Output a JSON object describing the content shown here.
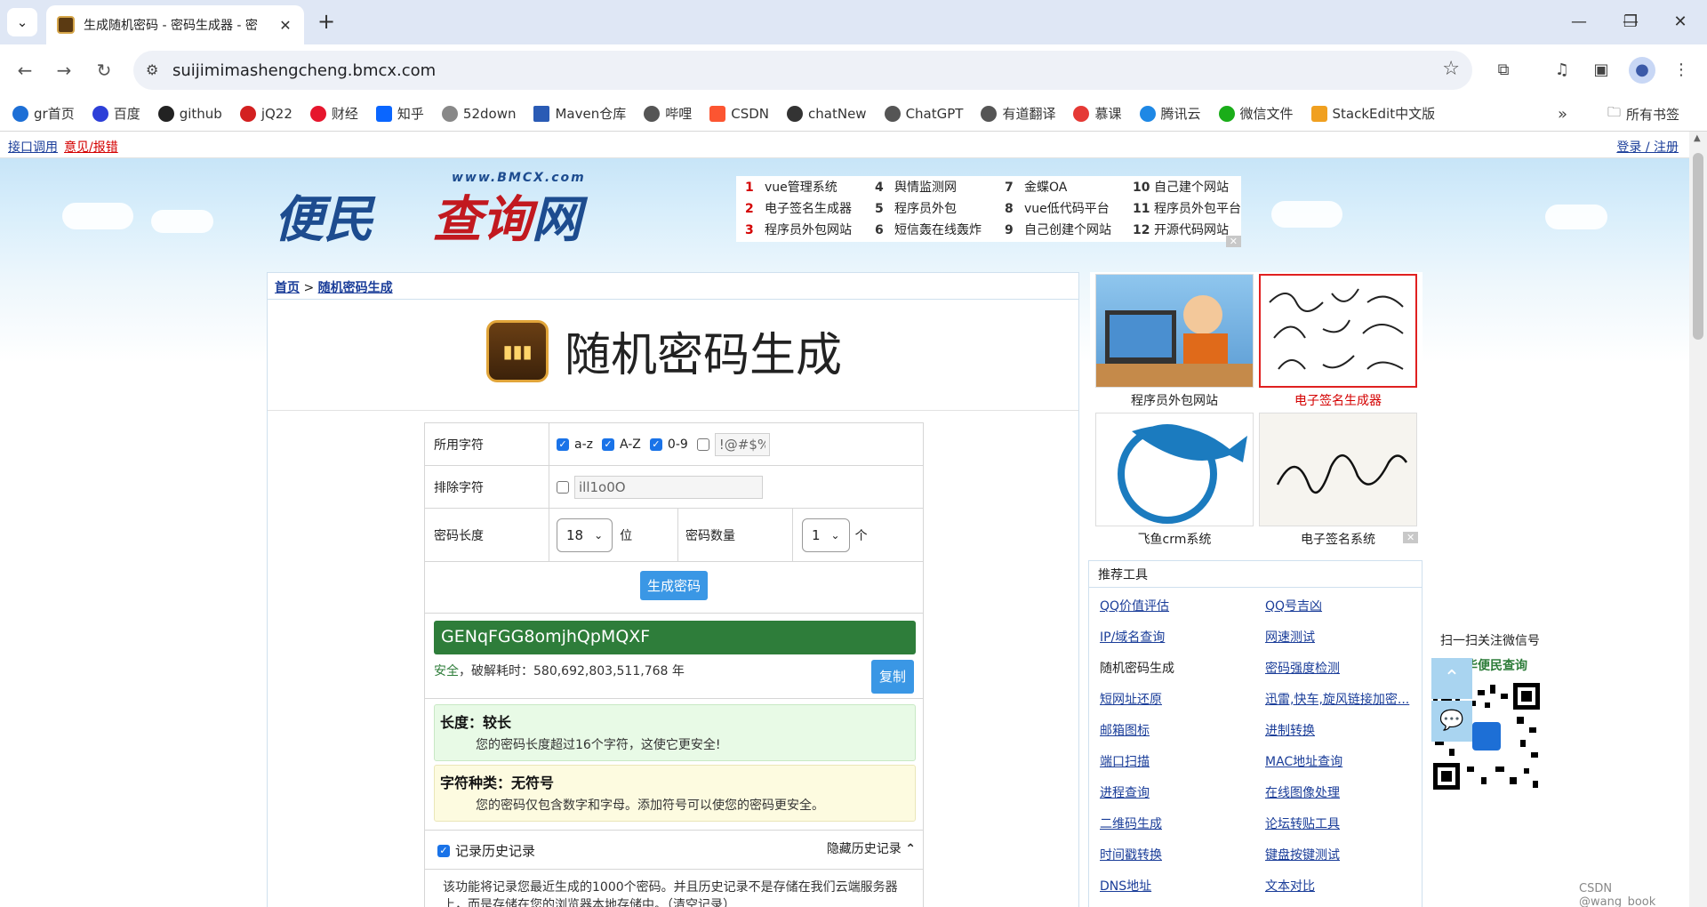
{
  "browser": {
    "tab_title": "生成随机密码 - 密码生成器 - 密",
    "url": "suijimimashengcheng.bmcx.com",
    "bookmarks": [
      "gr首页",
      "百度",
      "github",
      "jQ22",
      "财经",
      "知乎",
      "52down",
      "Maven仓库",
      "哔哩",
      "CSDN",
      "chatNew",
      "ChatGPT",
      "有道翻译",
      "慕课",
      "腾讯云",
      "微信文件",
      "StackEdit中文版"
    ],
    "all_bookmarks": "所有书签",
    "more": "»"
  },
  "topstrip": {
    "link1": "接口调用",
    "link2": "意见/报错",
    "login": "登录 / 注册"
  },
  "logo": {
    "url_text": "www.BMCX.com",
    "cn_a": "便民",
    "cn_b": "查询",
    "cn_c": "网"
  },
  "ads": [
    {
      "n": "1",
      "t": "vue管理系统",
      "red": true
    },
    {
      "n": "2",
      "t": "电子签名生成器",
      "red": true
    },
    {
      "n": "3",
      "t": "程序员外包网站",
      "red": true
    },
    {
      "n": "4",
      "t": "舆情监测网",
      "red": false
    },
    {
      "n": "5",
      "t": "程序员外包",
      "red": false
    },
    {
      "n": "6",
      "t": "短信轰在线轰炸",
      "red": false
    },
    {
      "n": "7",
      "t": "金蝶OA",
      "red": false
    },
    {
      "n": "8",
      "t": "vue低代码平台",
      "red": false
    },
    {
      "n": "9",
      "t": "自己创建个网站",
      "red": false
    },
    {
      "n": "10",
      "t": "自己建个网站",
      "red": false
    },
    {
      "n": "11",
      "t": "程序员外包平台",
      "red": false
    },
    {
      "n": "12",
      "t": "开源代码网站",
      "red": false
    }
  ],
  "breadcrumb": {
    "home": "首页",
    "sep": ">",
    "current": "随机密码生成"
  },
  "page_title": "随机密码生成",
  "form": {
    "chars_label": "所用字符",
    "opt_lower": "a-z",
    "opt_upper": "A-Z",
    "opt_digit": "0-9",
    "symbols_value": "!@#$%",
    "exclude_label": "排除字符",
    "exclude_value": "ill1o0O",
    "length_label": "密码长度",
    "length_value": "18",
    "length_unit": "位",
    "count_label": "密码数量",
    "count_value": "1",
    "count_unit": "个",
    "generate_label": "生成密码"
  },
  "result": {
    "password": "GENqFGG8omjhQpMQXF",
    "safe": "安全",
    "crack_prefix": "，破解耗时：",
    "crack_time": "580,692,803,511,768 年",
    "copy_label": "复制"
  },
  "tips": [
    {
      "title": "长度：较长",
      "desc": "您的密码长度超过16个字符，这使它更安全!"
    },
    {
      "title": "字符种类：无符号",
      "desc": "您的密码仅包含数字和字母。添加符号可以使您的密码更安全。"
    }
  ],
  "history": {
    "record_label": "记录历史记录",
    "hide_label": "隐藏历史记录",
    "desc": "该功能将记录您最近生成的1000个密码。并且历史记录不是存储在我们云端服务器上，而是存储在您的浏览器本地存储中。（清空记录）"
  },
  "side": {
    "captions": [
      "程序员外包网站",
      "电子签名生成器",
      "飞鱼crm系统",
      "电子签名系统"
    ],
    "tools_title": "推荐工具",
    "tools": [
      [
        "QQ价值评估",
        "QQ号吉凶"
      ],
      [
        "IP/域名查询",
        "网速测试"
      ],
      [
        "随机密码生成",
        "密码强度检测"
      ],
      [
        "短网址还原",
        "迅雷,快车,旋风链接加密..."
      ],
      [
        "邮箱图标",
        "进制转换"
      ],
      [
        "端口扫描",
        "MAC地址查询"
      ],
      [
        "进程查询",
        "在线图像处理"
      ],
      [
        "二维码生成",
        "论坛转贴工具"
      ],
      [
        "时间戳转换",
        "键盘按键测试"
      ],
      [
        "DNS地址",
        "文本对比"
      ]
    ]
  },
  "wechat": {
    "line1": "扫一扫关注微信号",
    "line2": "诚华便民查询"
  },
  "watermark": "CSDN @wang_book"
}
